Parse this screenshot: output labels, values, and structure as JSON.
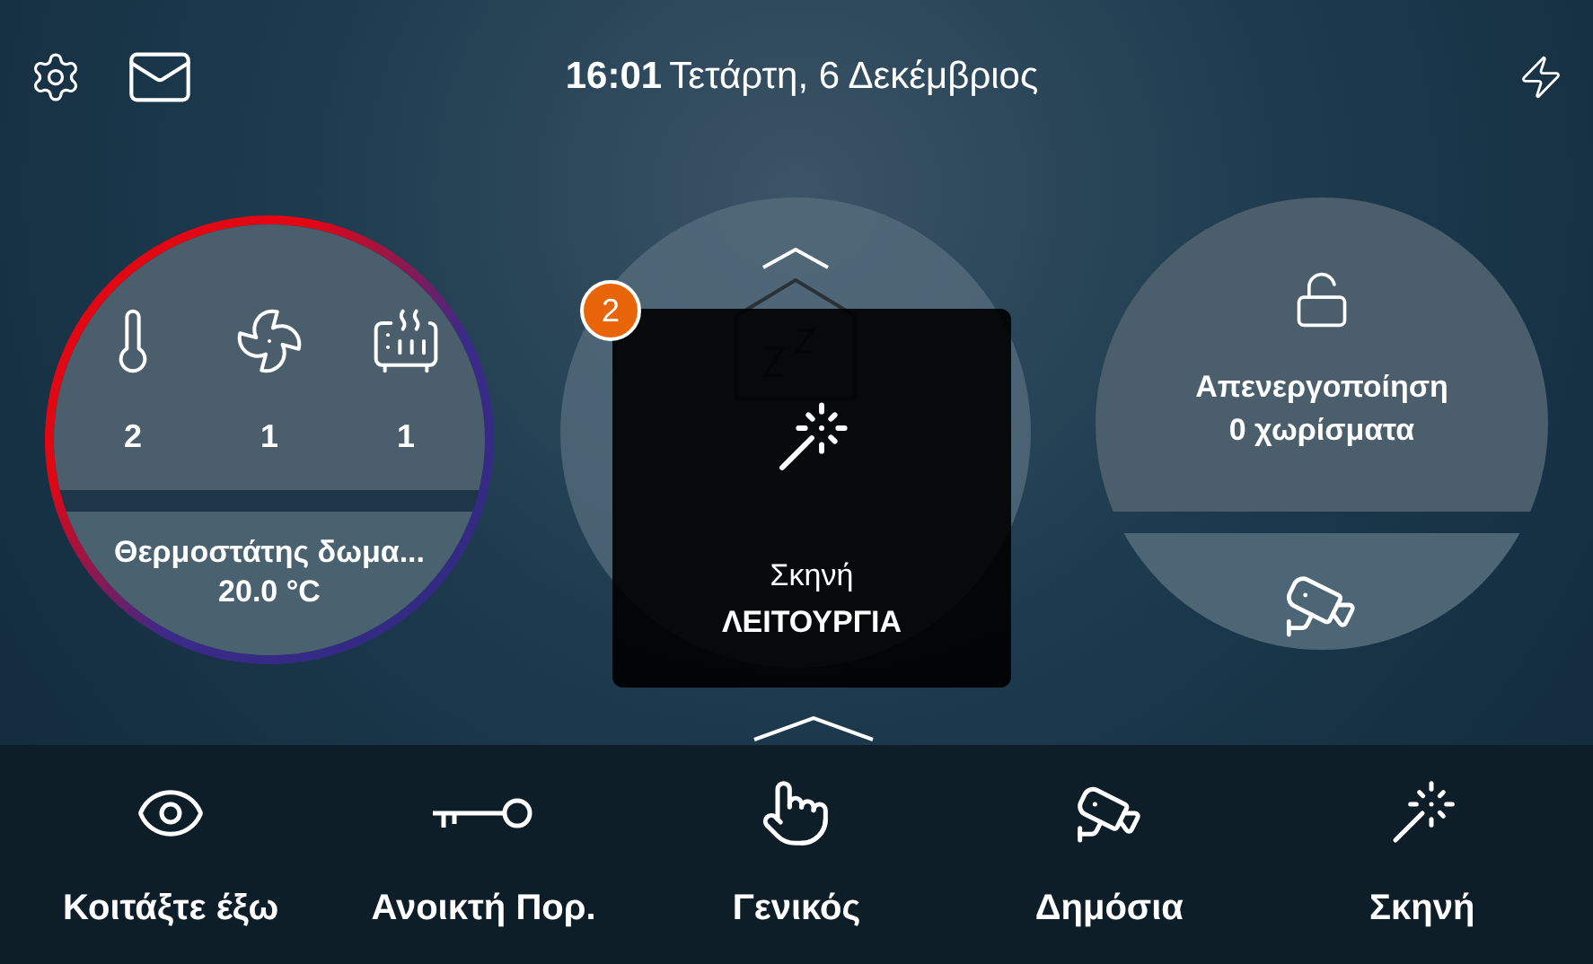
{
  "status_bar": {
    "time": "16:01",
    "date": "Τετάρτη, 6 Δεκέμβριος"
  },
  "thermostat": {
    "counters": [
      {
        "kind": "thermometer",
        "count": "2"
      },
      {
        "kind": "fan",
        "count": "1"
      },
      {
        "kind": "heater",
        "count": "1"
      }
    ],
    "name": "Θερμοστάτης δωμα...",
    "temperature": "20.0 °C"
  },
  "scenario_popup": {
    "badge": "2",
    "title": "Σκηνή",
    "subtitle": "ΛΕΙΤΟΥΡΓΙΑ"
  },
  "alarm": {
    "status": "Απενεργοποίηση",
    "zones": "0 χωρίσματα"
  },
  "nav": [
    {
      "kind": "eye",
      "label": "Κοιτάξτε έξω"
    },
    {
      "kind": "key",
      "label": "Ανοικτή Πορ."
    },
    {
      "kind": "touch",
      "label": "Γενικός"
    },
    {
      "kind": "camera",
      "label": "Δημόσια"
    },
    {
      "kind": "wand",
      "label": "Σκηνή"
    }
  ]
}
